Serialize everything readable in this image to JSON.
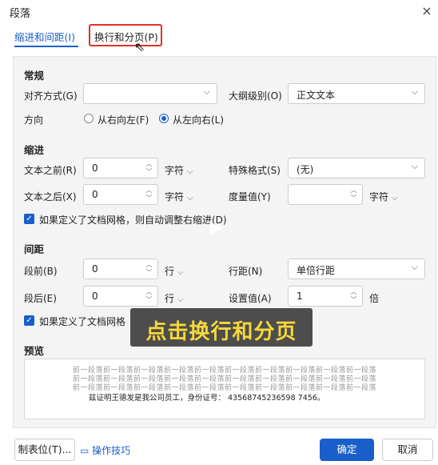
{
  "window": {
    "title": "段落",
    "close_glyph": "×"
  },
  "tabs": [
    {
      "label": "缩进和间距(I)",
      "active": true
    },
    {
      "label": "换行和分页(P)",
      "active": false
    }
  ],
  "general": {
    "section": "常规",
    "alignment_label": "对齐方式(G)",
    "alignment_value": "",
    "outline_label": "大纲级别(O)",
    "outline_value": "正文文本",
    "direction_label": "方向",
    "rtl_label": "从右向左(F)",
    "ltr_label": "从左向右(L)",
    "direction_selected": "ltr"
  },
  "indent": {
    "section": "缩进",
    "before_label": "文本之前(R)",
    "before_value": "0",
    "before_unit": "字符",
    "after_label": "文本之后(X)",
    "after_value": "0",
    "after_unit": "字符",
    "special_label": "特殊格式(S)",
    "special_value": "(无)",
    "measure_label": "度量值(Y)",
    "measure_value": "",
    "measure_unit": "字符",
    "grid_check_label": "如果定义了文档网格，则自动调整右缩进(D)"
  },
  "spacing": {
    "section": "间距",
    "before_label": "段前(B)",
    "before_value": "0",
    "before_unit": "行",
    "after_label": "段后(E)",
    "after_value": "0",
    "after_unit": "行",
    "line_label": "行距(N)",
    "line_value": "单倍行距",
    "setting_label": "设置值(A)",
    "setting_value": "1",
    "setting_unit": "倍",
    "grid_check_label": "如果定义了文档网格"
  },
  "preview": {
    "section": "预览",
    "gray_line": "前一段落前一段落前一段落前一段落前一段落前一段落前一段落前一段落前一段落前一段落",
    "main_text": "兹证明王德发是我公司员工，身份证号： 43568745236598 7456。"
  },
  "overlay_caption": "点击换行和分页",
  "footer": {
    "tabs_button": "制表位(T)...",
    "tips_link": "操作技巧",
    "ok": "确定",
    "cancel": "取消"
  },
  "icons": {
    "chevron": "⌵",
    "up": "︿",
    "down": "﹀",
    "check": "✓",
    "play": "▶",
    "tips": "▭",
    "cursor": "⇖"
  },
  "colors": {
    "accent": "#1a5fc9",
    "highlight": "#e0302a",
    "caption_text": "#f6d83a"
  }
}
